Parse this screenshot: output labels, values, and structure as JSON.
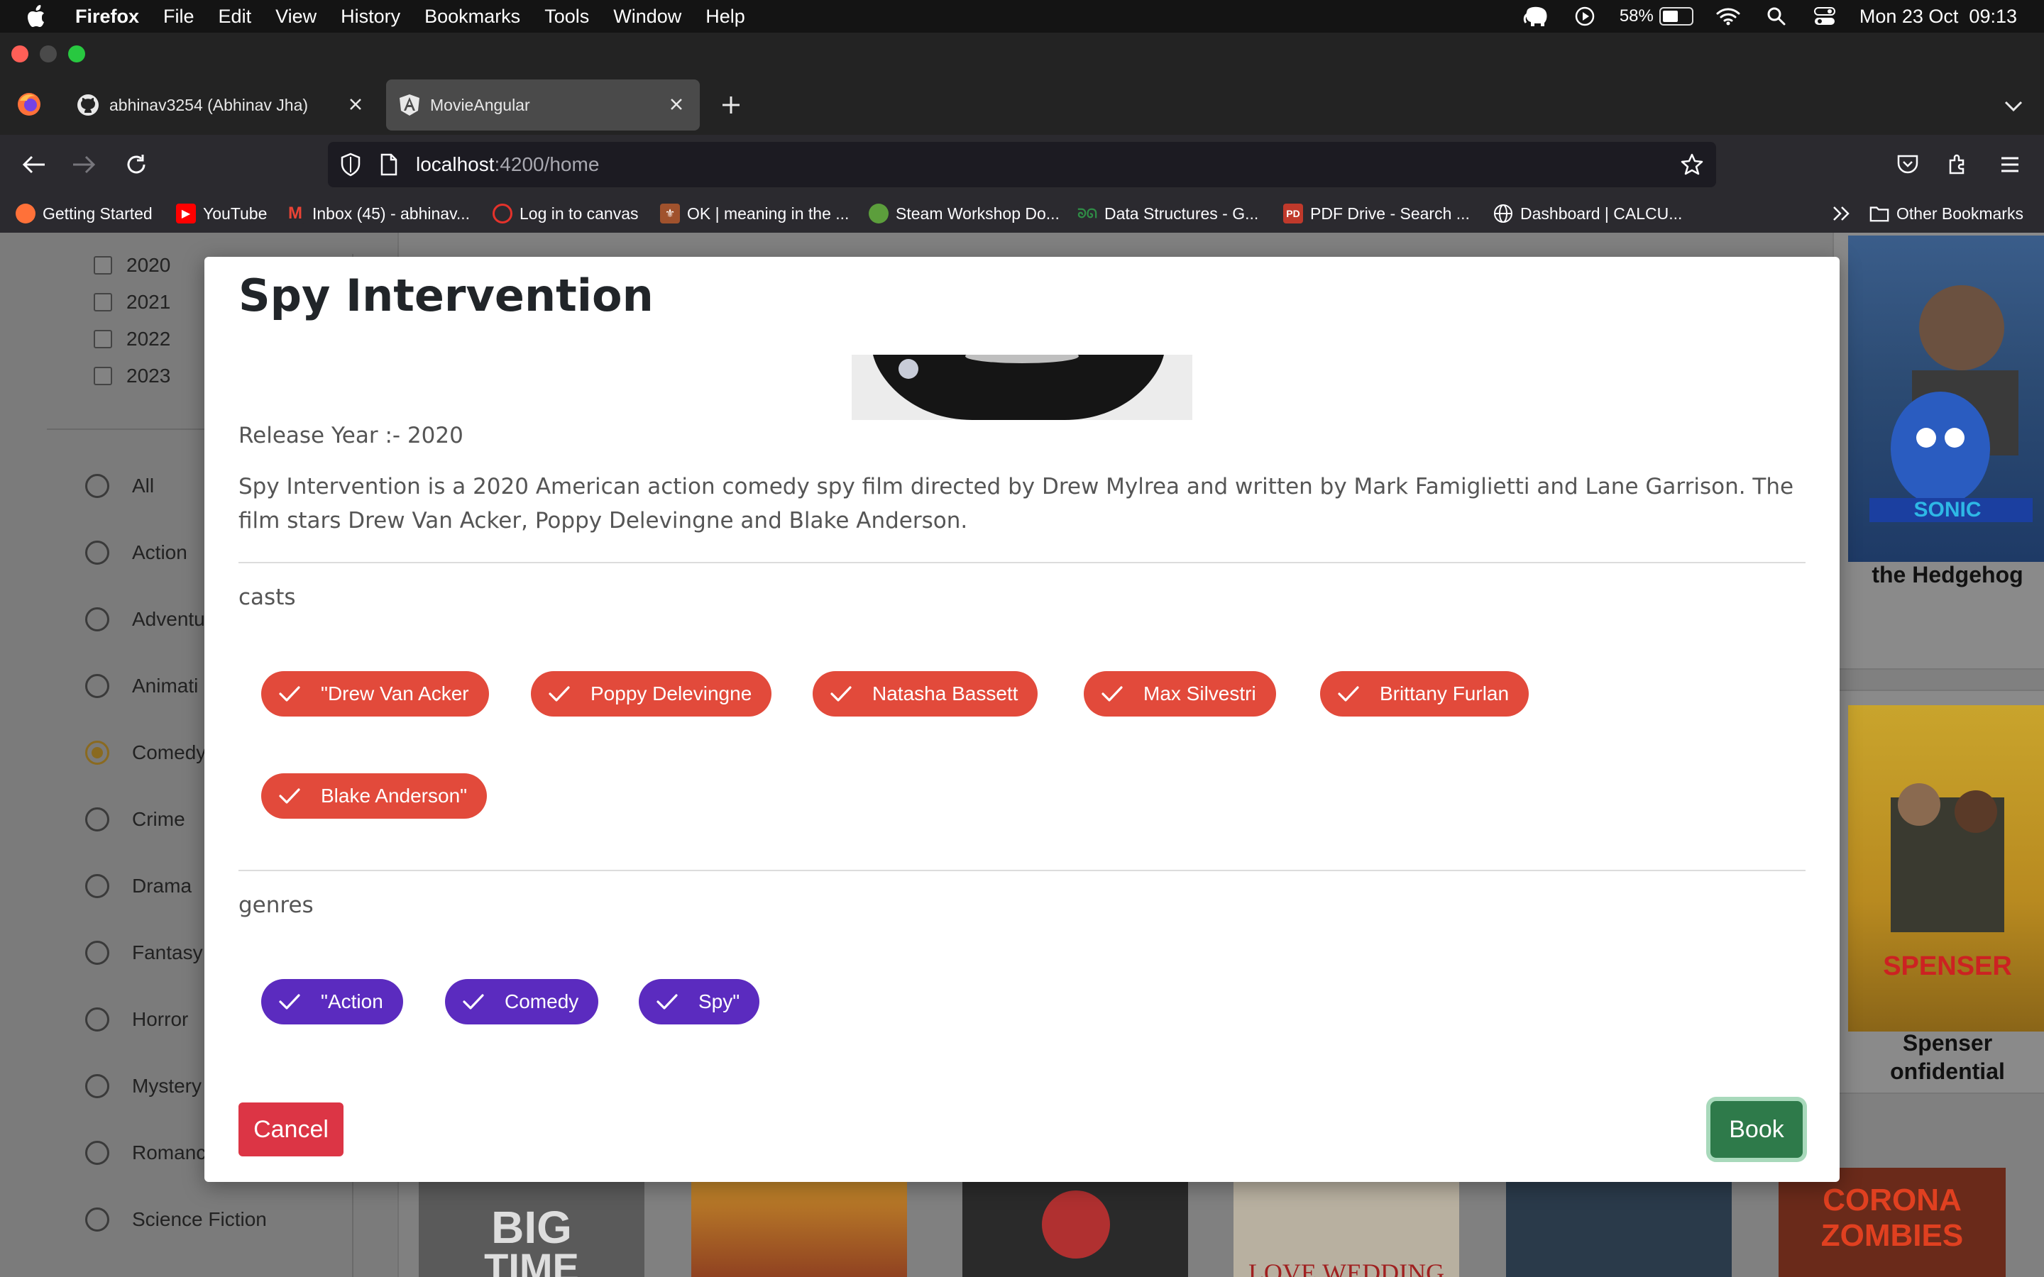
{
  "menubar": {
    "app": "Firefox",
    "items": [
      "File",
      "Edit",
      "View",
      "History",
      "Bookmarks",
      "Tools",
      "Window",
      "Help"
    ],
    "battery_percent": "58%",
    "battery_level": 0.58,
    "datetime": "Mon 23 Oct  09:13"
  },
  "tabs": [
    {
      "label": "abhinav3254 (Abhinav Jha)",
      "icon": "github-icon"
    },
    {
      "label": "MovieAngular",
      "icon": "angular-icon"
    }
  ],
  "url": {
    "host": "localhost",
    "rest": ":4200/home"
  },
  "bookmarks": [
    {
      "label": "Getting Started",
      "icon": "firefox-icon"
    },
    {
      "label": "YouTube",
      "icon": "youtube-icon"
    },
    {
      "label": "Inbox (45) - abhinav...",
      "icon": "gmail-icon"
    },
    {
      "label": "Log in to canvas",
      "icon": "canvas-icon"
    },
    {
      "label": "OK | meaning in the ...",
      "icon": "cambridge-icon"
    },
    {
      "label": "Steam Workshop Do...",
      "icon": "steam-icon"
    },
    {
      "label": "Data Structures - G...",
      "icon": "gfg-icon"
    },
    {
      "label": "PDF Drive - Search ...",
      "icon": "pdfdrive-icon"
    },
    {
      "label": "Dashboard | CALCU...",
      "icon": "globe-icon"
    }
  ],
  "other_bookmarks": "Other Bookmarks",
  "sidebar": {
    "years": [
      "2020",
      "2021",
      "2022",
      "2023"
    ],
    "genres": [
      "All",
      "Action",
      "Adventu",
      "Animati",
      "Comedy",
      "Crime",
      "Drama",
      "Fantasy",
      "Horror",
      "Mystery",
      "Romanc",
      "Science Fiction"
    ],
    "selected_genre": "Comedy"
  },
  "background_cards": {
    "card1_title": "the Hedgehog",
    "card2_title": "Spenser\nonfidential"
  },
  "modal": {
    "title": "Spy Intervention",
    "release_year": "Release Year :- 2020",
    "description": "Spy Intervention is a 2020 American action comedy spy film directed by Drew Mylrea and written by Mark Famiglietti and Lane Garrison. The film stars Drew Van Acker, Poppy Delevingne and Blake Anderson.",
    "casts_label": "casts",
    "casts": [
      "\"Drew Van Acker",
      "Poppy Delevingne",
      "Natasha Bassett",
      "Max Silvestri",
      "Brittany Furlan",
      "Blake Anderson\""
    ],
    "genres_label": "genres",
    "genres": [
      "\"Action",
      "Comedy",
      "Spy\""
    ],
    "cancel_label": "Cancel",
    "book_label": "Book"
  },
  "colors": {
    "cast_chip": "#e24a3b",
    "genre_chip": "#5b2bbf",
    "cancel": "#dc3545",
    "book": "#2e7a4a"
  }
}
